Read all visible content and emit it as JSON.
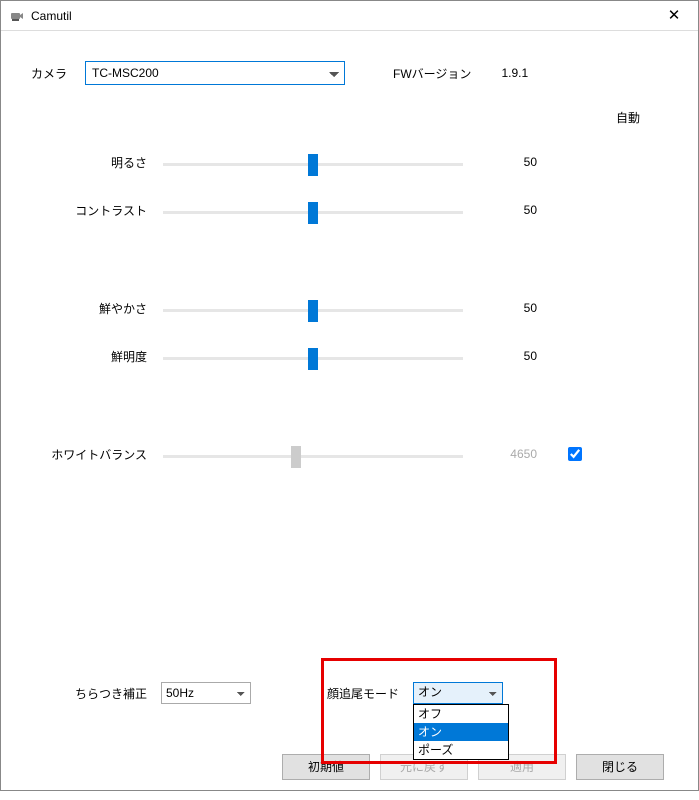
{
  "window": {
    "title": "Camutil"
  },
  "top": {
    "camera_label": "カメラ",
    "camera_value": "TC-MSC200",
    "fw_label": "FWバージョン",
    "fw_value": "1.9.1"
  },
  "auto_header": "自動",
  "sliders": {
    "brightness": {
      "label": "明るさ",
      "value": "50",
      "n": 50,
      "min": 0,
      "max": 100
    },
    "contrast": {
      "label": "コントラスト",
      "value": "50",
      "n": 50,
      "min": 0,
      "max": 100
    },
    "saturation": {
      "label": "鮮やかさ",
      "value": "50",
      "n": 50,
      "min": 0,
      "max": 100
    },
    "sharpness": {
      "label": "鮮明度",
      "value": "50",
      "n": 50,
      "min": 0,
      "max": 100
    },
    "whitebal": {
      "label": "ホワイトバランス",
      "value": "4650",
      "n": 4650,
      "min": 2000,
      "max": 8000
    }
  },
  "flicker": {
    "label": "ちらつき補正",
    "value": "50Hz"
  },
  "face": {
    "label": "顔追尾モード",
    "value": "オン",
    "options": {
      "off": "オフ",
      "on": "オン",
      "pause": "ポーズ"
    }
  },
  "buttons": {
    "default": "初期値",
    "undo": "元に戻す",
    "apply": "適用",
    "close": "閉じる"
  }
}
